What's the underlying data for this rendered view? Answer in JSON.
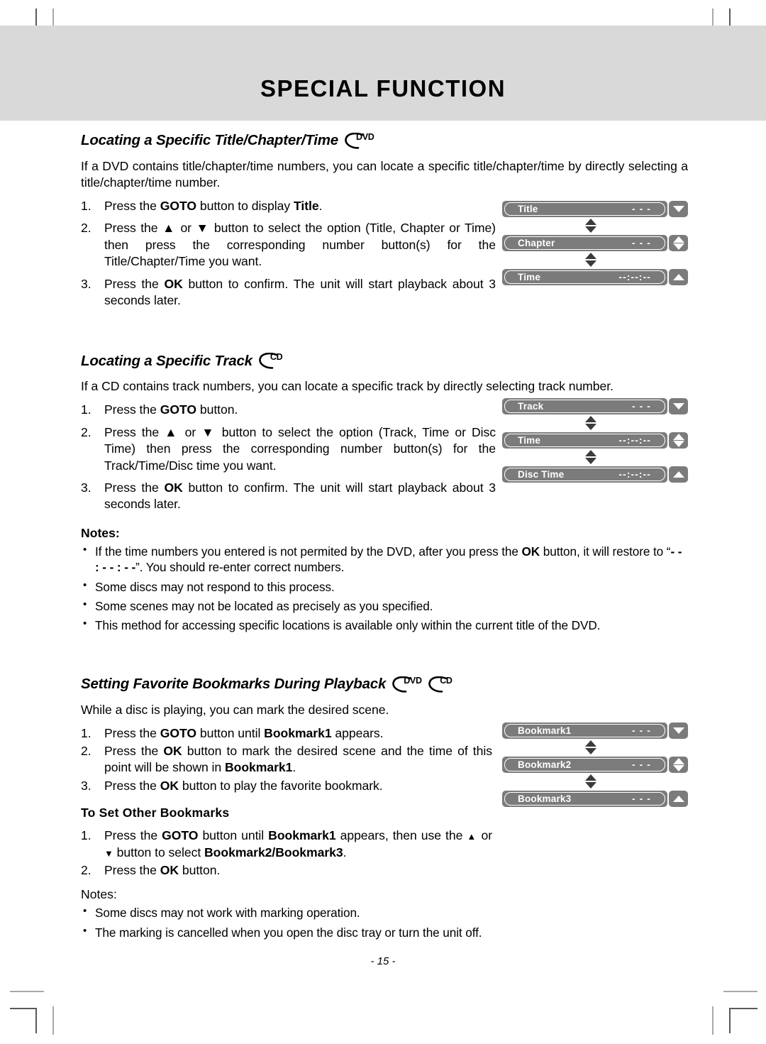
{
  "page": {
    "title": "SPECIAL FUNCTION",
    "number": "- 15 -"
  },
  "sections": [
    {
      "heading": "Locating a Specific Title/Chapter/Time",
      "badges": [
        "DVD"
      ],
      "intro": "If a DVD contains title/chapter/time numbers, you can locate a specific title/chapter/time by directly selecting a title/chapter/time number.",
      "steps": [
        {
          "num": "1.",
          "text_parts": [
            "Press the ",
            "GOTO",
            " button to display ",
            "Title",
            "."
          ]
        },
        {
          "num": "2.",
          "text_parts": [
            "Press the ▲ or ▼ button to select the option (Title, Chapter or Time) then press the corresponding number button(s) for the Title/Chapter/Time you want."
          ]
        },
        {
          "num": "3.",
          "text_parts": [
            "Press the ",
            "OK",
            " button to confirm. The unit will start playback about 3 seconds later."
          ]
        }
      ],
      "osd": [
        {
          "label": "Title",
          "value": "- - -",
          "button": "down"
        },
        {
          "label": "Chapter",
          "value": "- - -",
          "button": "up-down"
        },
        {
          "label": "Time",
          "value": "--:--:--",
          "button": "up"
        }
      ]
    },
    {
      "heading": "Locating a Specific Track",
      "badges": [
        "CD"
      ],
      "intro": "If a CD contains track numbers,  you can locate a specific track by directly selecting track number.",
      "steps": [
        {
          "num": "1.",
          "text_parts": [
            "Press the ",
            "GOTO",
            " button."
          ]
        },
        {
          "num": "2.",
          "text_parts": [
            "Press the ▲ or ▼ button to select the option (Track, Time or Disc Time) then press the corresponding number button(s) for the Track/Time/Disc time you want."
          ]
        },
        {
          "num": "3.",
          "text_parts": [
            "Press the ",
            "OK",
            " button to confirm. The unit will start playback about 3 seconds later."
          ]
        }
      ],
      "osd": [
        {
          "label": "Track",
          "value": "- - -",
          "button": "down"
        },
        {
          "label": "Time",
          "value": "--:--:--",
          "button": "up-down"
        },
        {
          "label": "Disc Time",
          "value": "--:--:--",
          "button": "up"
        }
      ]
    },
    {
      "heading": "Setting Favorite Bookmarks During Playback",
      "badges": [
        "DVD",
        "CD"
      ],
      "intro": "While a disc is playing, you can mark the desired scene.",
      "steps": [
        {
          "num": "1.",
          "text_parts": [
            "Press the ",
            "GOTO",
            " button until ",
            "Bookmark1",
            " appears."
          ]
        },
        {
          "num": "2.",
          "text_parts": [
            "Press the ",
            "OK",
            " button to mark the desired scene and the time of this point will be shown in ",
            "Bookmark1",
            "."
          ]
        },
        {
          "num": "3.",
          "text_parts": [
            "Press the ",
            "OK",
            " button to play the favorite bookmark."
          ]
        }
      ],
      "osd": [
        {
          "label": "Bookmark1",
          "value": "- - -",
          "button": "down"
        },
        {
          "label": "Bookmark2",
          "value": "- - -",
          "button": "up-down"
        },
        {
          "label": "Bookmark3",
          "value": "- - -",
          "button": "up"
        }
      ]
    }
  ],
  "notes_block_1": {
    "title": "Notes:",
    "items": [
      "If the time numbers you entered is not permited by the DVD, after you press the OK button, it will restore to “- - : - - : - -”. You should re-enter correct numbers.",
      "Some discs may not respond to this process.",
      "Some scenes may not be located as precisely as you specified.",
      "This method for accessing specific locations is available only within the current title of the DVD."
    ]
  },
  "subsection": {
    "title": "To Set Other Bookmarks",
    "steps": [
      {
        "num": "1.",
        "text": "Press the GOTO button until Bookmark1 appears, then use the ▲ or ▼ button to select Bookmark2/Bookmark3."
      },
      {
        "num": "2.",
        "text": "Press the OK button."
      }
    ]
  },
  "notes_block_2": {
    "title": "Notes:",
    "items": [
      "Some discs may not work with marking operation.",
      "The marking is cancelled when you open the disc tray or turn the unit off."
    ]
  },
  "colors": {
    "header_band": "#d9d9d9",
    "osd_fill": "#7b7b7b",
    "osd_text": "#ffffff",
    "connector_arrow": "#3b3b3b"
  }
}
